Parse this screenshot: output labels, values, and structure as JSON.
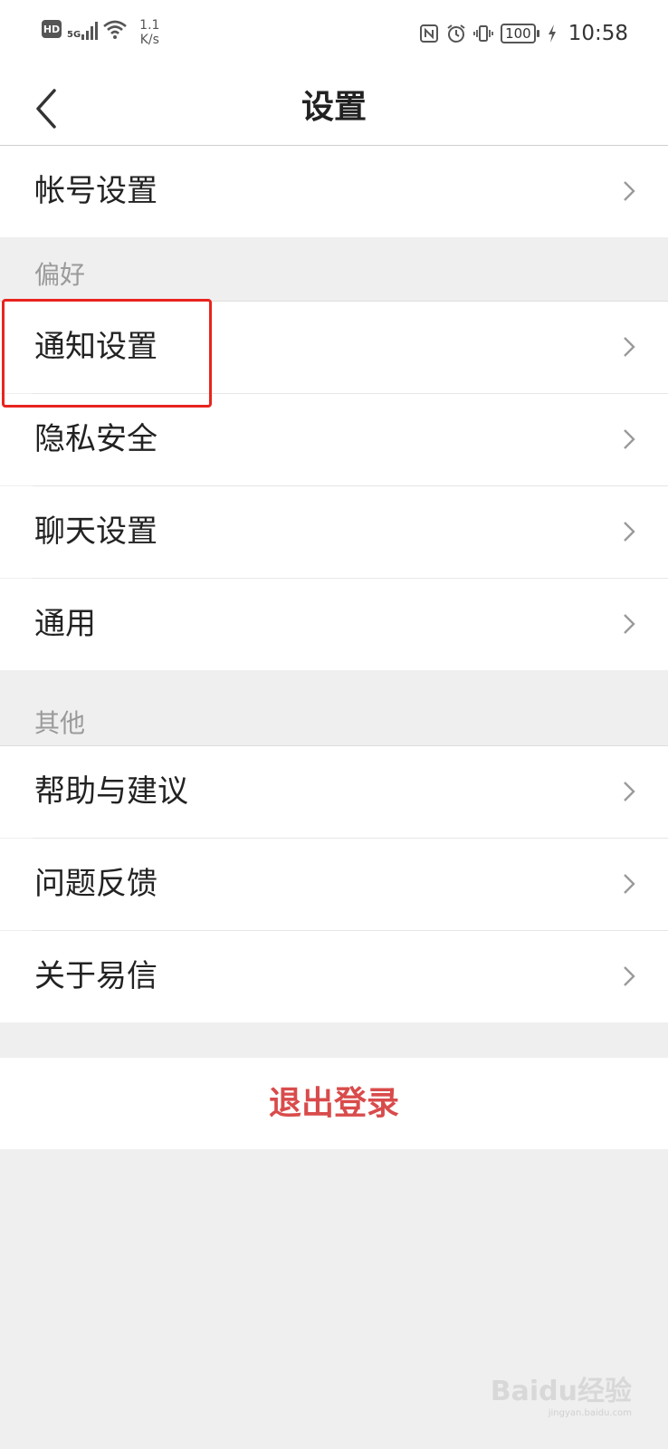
{
  "status_bar": {
    "hd": "HD",
    "network": "5G",
    "speed_value": "1.1",
    "speed_unit": "K/s",
    "battery": "100",
    "time": "10:58"
  },
  "header": {
    "title": "设置"
  },
  "account_row": {
    "label": "帐号设置"
  },
  "preferences": {
    "section_label": "偏好",
    "items": [
      {
        "label": "通知设置"
      },
      {
        "label": "隐私安全"
      },
      {
        "label": "聊天设置"
      },
      {
        "label": "通用"
      }
    ]
  },
  "others": {
    "section_label": "其他",
    "items": [
      {
        "label": "帮助与建议"
      },
      {
        "label": "问题反馈"
      },
      {
        "label": "关于易信"
      }
    ]
  },
  "logout": {
    "label": "退出登录"
  },
  "watermark": {
    "brand": "Baidu经验",
    "url": "jingyan.baidu.com"
  },
  "colors": {
    "logout": "#d94b4b",
    "highlight": "#e8241f",
    "background": "#efefef"
  }
}
